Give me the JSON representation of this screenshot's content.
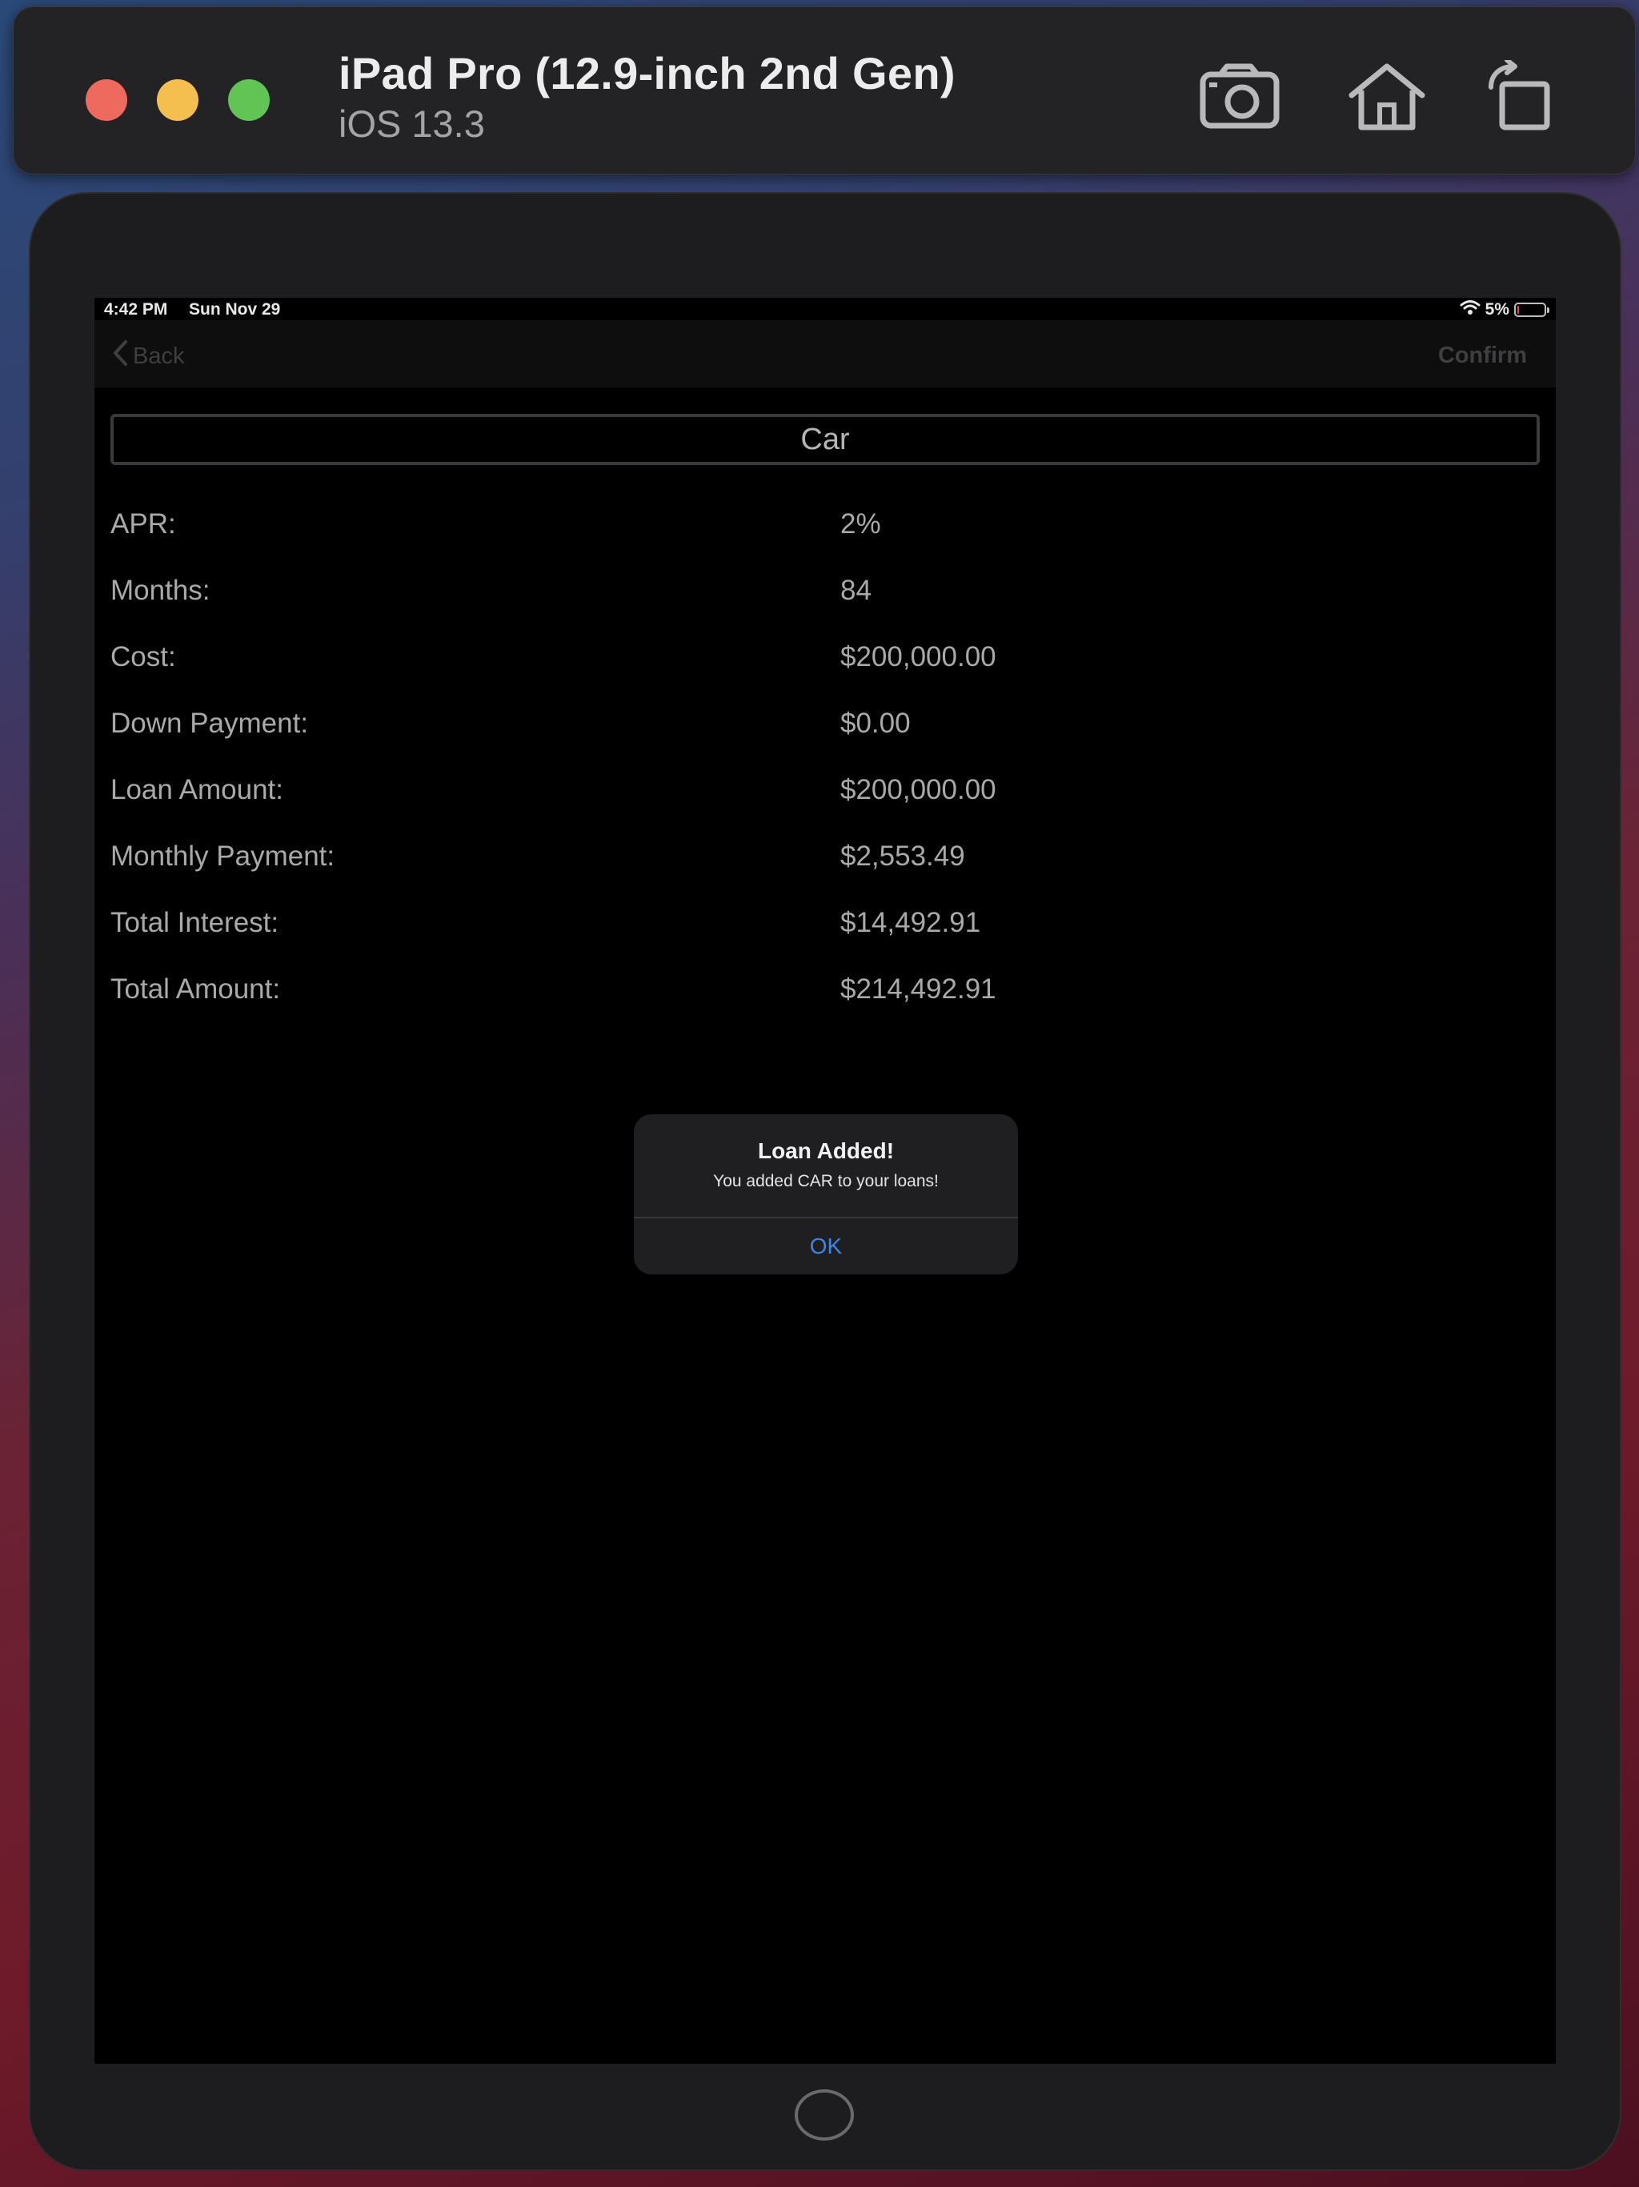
{
  "simulator": {
    "device_name": "iPad Pro (12.9-inch 2nd Gen)",
    "os_version": "iOS 13.3",
    "icons": [
      "screenshot-camera-icon",
      "home-icon",
      "rotate-icon"
    ]
  },
  "status_bar": {
    "time": "4:42 PM",
    "date": "Sun Nov 29",
    "battery": "5%",
    "battery_level": 0.05
  },
  "nav": {
    "back_label": "Back",
    "confirm_label": "Confirm"
  },
  "loan": {
    "name": "Car",
    "rows": [
      {
        "label": "APR:",
        "value": "2%"
      },
      {
        "label": "Months:",
        "value": "84"
      },
      {
        "label": "Cost:",
        "value": "$200,000.00"
      },
      {
        "label": "Down Payment:",
        "value": "$0.00"
      },
      {
        "label": "Loan Amount:",
        "value": "$200,000.00"
      },
      {
        "label": "Monthly Payment:",
        "value": "$2,553.49"
      },
      {
        "label": "Total Interest:",
        "value": "$14,492.91"
      },
      {
        "label": "Total Amount:",
        "value": "$214,492.91"
      }
    ]
  },
  "alert": {
    "title": "Loan Added!",
    "message": "You added CAR to your loans!",
    "ok_label": "OK"
  },
  "colors": {
    "accent": "#3d86e8",
    "screen_background": "#000000",
    "alert_background": "#1f1f21"
  }
}
